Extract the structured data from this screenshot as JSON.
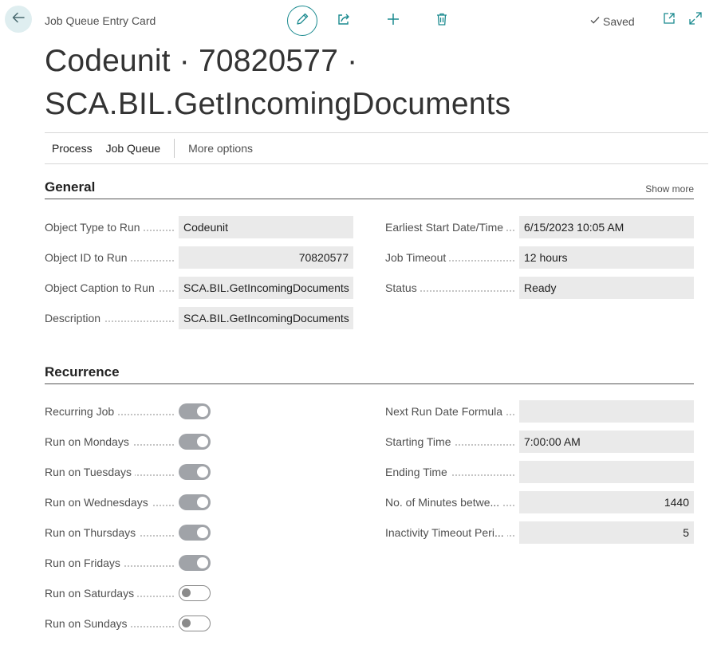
{
  "header": {
    "page_type": "Job Queue Entry Card",
    "saved_label": "Saved",
    "title": "Codeunit · 70820577 · SCA.BIL.GetIncomingDocuments"
  },
  "actions": {
    "process": "Process",
    "job_queue": "Job Queue",
    "more_options": "More options"
  },
  "general": {
    "title": "General",
    "show_more": "Show more",
    "left": [
      {
        "label": "Object Type to Run",
        "value": "Codeunit"
      },
      {
        "label": "Object ID to Run",
        "value": "70820577"
      },
      {
        "label": "Object Caption to Run",
        "value": "SCA.BIL.GetIncomingDocuments"
      },
      {
        "label": "Description",
        "value": "SCA.BIL.GetIncomingDocuments"
      }
    ],
    "right": [
      {
        "label": "Earliest Start Date/Time",
        "value": "6/15/2023 10:05 AM"
      },
      {
        "label": "Job Timeout",
        "value": "12 hours"
      },
      {
        "label": "Status",
        "value": "Ready"
      }
    ]
  },
  "recurrence": {
    "title": "Recurrence",
    "toggles": [
      {
        "label": "Recurring Job",
        "on": true
      },
      {
        "label": "Run on Mondays",
        "on": true
      },
      {
        "label": "Run on Tuesdays",
        "on": true
      },
      {
        "label": "Run on Wednesdays",
        "on": true
      },
      {
        "label": "Run on Thursdays",
        "on": true
      },
      {
        "label": "Run on Fridays",
        "on": true
      },
      {
        "label": "Run on Saturdays",
        "on": false
      },
      {
        "label": "Run on Sundays",
        "on": false
      }
    ],
    "right": [
      {
        "label": "Next Run Date Formula",
        "value": ""
      },
      {
        "label": "Starting Time",
        "value": "7:00:00 AM"
      },
      {
        "label": "Ending Time",
        "value": ""
      },
      {
        "label": "No. of Minutes betwe...",
        "value": "1440"
      },
      {
        "label": "Inactivity Timeout Peri...",
        "value": "5"
      }
    ]
  },
  "icons": {
    "back": "arrow-left-icon",
    "edit": "pencil-icon",
    "share": "share-icon",
    "new": "plus-icon",
    "delete": "trash-icon",
    "saved": "checkmark-icon",
    "open_new_window": "open-in-new-window-icon",
    "expand": "expand-icon"
  },
  "colors": {
    "accent": "#1a8a8f",
    "back_button_bg": "#dfeef0",
    "field_bg": "#eaeaea",
    "toggle_on": "#a0a3a8"
  }
}
